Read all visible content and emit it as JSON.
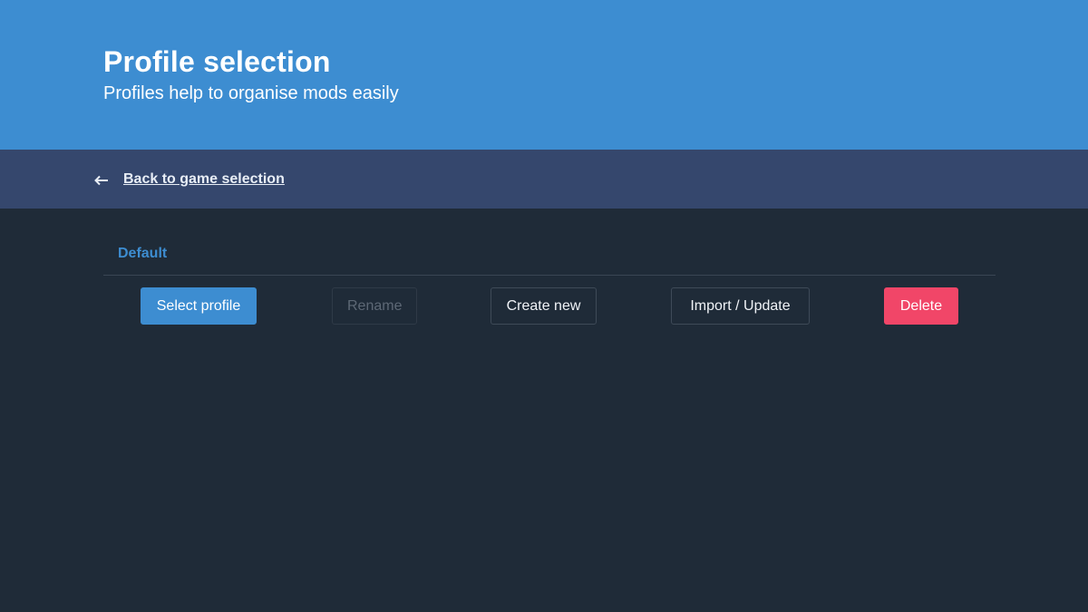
{
  "hero": {
    "title": "Profile selection",
    "subtitle": "Profiles help to organise mods easily",
    "background_color": "#3d8dd1"
  },
  "navbar": {
    "back_link_label": "Back to game selection",
    "back_icon": "arrow-left-icon",
    "background_color": "#35476d"
  },
  "profiles": {
    "items": [
      {
        "name": "Default",
        "selected": true
      }
    ]
  },
  "actions": {
    "select_label": "Select profile",
    "rename_label": "Rename",
    "rename_disabled": true,
    "create_label": "Create new",
    "import_label": "Import / Update",
    "delete_label": "Delete"
  },
  "colors": {
    "page_background": "#1f2b38",
    "accent": "#3d8dd1",
    "danger": "#f14668"
  }
}
